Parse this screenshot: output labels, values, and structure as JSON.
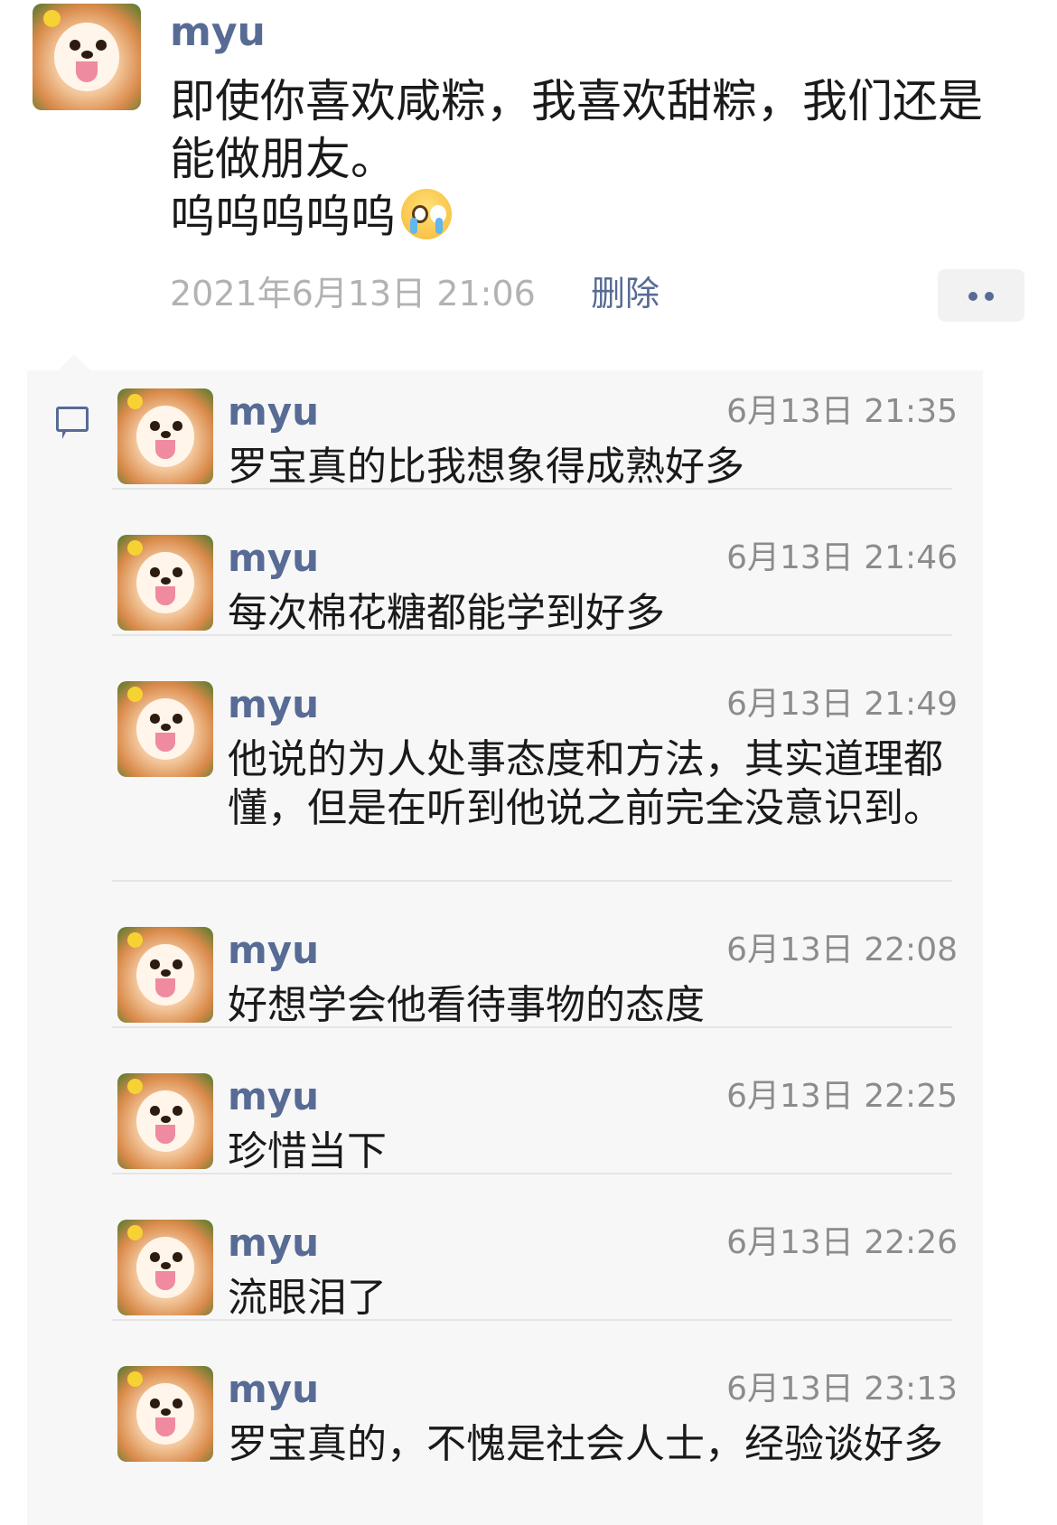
{
  "post": {
    "author": "myu",
    "text_line1": "即使你喜欢咸粽，我喜欢甜粽，我们还是",
    "text_line2": "能做朋友。",
    "text_line3": "呜呜呜呜呜",
    "emoji": "crying-face-emoji",
    "time": "2021年6月13日 21:06",
    "delete_label": "删除",
    "more_icon": "more-dots-icon"
  },
  "comments": [
    {
      "author": "myu",
      "time": "6月13日 21:35",
      "text": "罗宝真的比我想象得成熟好多"
    },
    {
      "author": "myu",
      "time": "6月13日 21:46",
      "text": "每次棉花糖都能学到好多"
    },
    {
      "author": "myu",
      "time": "6月13日 21:49",
      "text": "他说的为人处事态度和方法，其实道理都懂，但是在听到他说之前完全没意识到。"
    },
    {
      "author": "myu",
      "time": "6月13日 22:08",
      "text": "好想学会他看待事物的态度"
    },
    {
      "author": "myu",
      "time": "6月13日 22:25",
      "text": "珍惜当下"
    },
    {
      "author": "myu",
      "time": "6月13日 22:26",
      "text": "流眼泪了"
    },
    {
      "author": "myu",
      "time": "6月13日 23:13",
      "text": "罗宝真的，不愧是社会人士，经验谈好多"
    }
  ],
  "comment_icon": "comment-bubble-icon",
  "colors": {
    "link": "#576b95",
    "muted": "#b2b2b2",
    "panel": "#f7f7f7"
  }
}
